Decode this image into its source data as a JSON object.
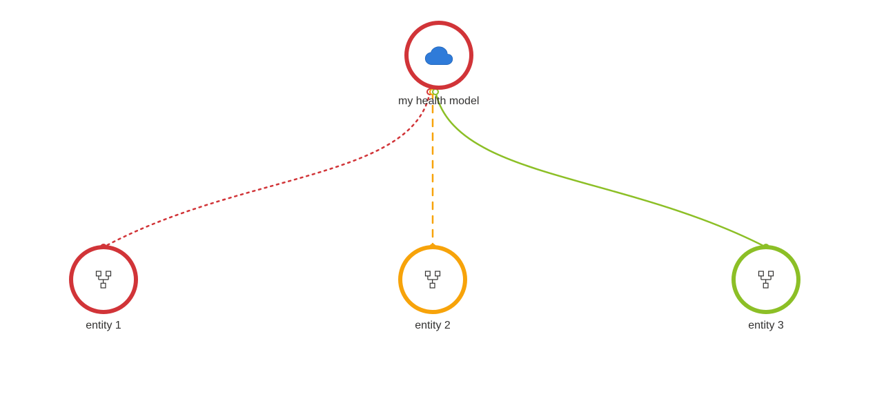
{
  "root": {
    "label": "my health model",
    "status_color": "#d13438",
    "icon": "cloud-icon"
  },
  "children": [
    {
      "label": "entity 1",
      "status_color": "#d13438",
      "edge_style": "dotted",
      "icon": "hierarchy-icon"
    },
    {
      "label": "entity 2",
      "status_color": "#f7a30a",
      "edge_style": "dashed",
      "icon": "hierarchy-icon"
    },
    {
      "label": "entity 3",
      "status_color": "#8cbf26",
      "edge_style": "solid",
      "icon": "hierarchy-icon"
    }
  ],
  "colors": {
    "red": "#d13438",
    "orange": "#f7a30a",
    "green": "#8cbf26",
    "cloud_fill": "#2f7bd9",
    "cloud_stroke": "#1b5fb4",
    "icon_stroke": "#323130",
    "text": "#323130"
  }
}
